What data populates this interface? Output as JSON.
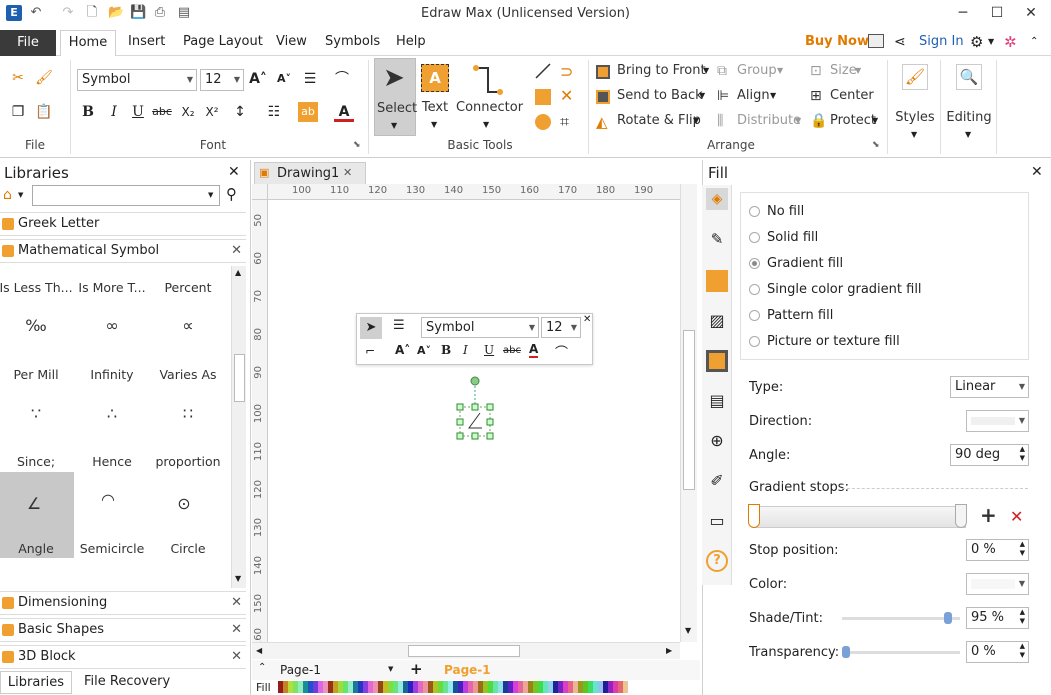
{
  "window": {
    "title": "Edraw Max (Unlicensed Version)",
    "minimize": "─",
    "maximize": "☐",
    "close": "✕"
  },
  "menu": {
    "file": "File",
    "home": "Home",
    "insert": "Insert",
    "page_layout": "Page Layout",
    "view": "View",
    "symbols": "Symbols",
    "help": "Help",
    "buy_now": "Buy Now",
    "sign_in": "Sign In"
  },
  "ribbon": {
    "groups": {
      "file": "File",
      "font": "Font",
      "basic_tools": "Basic Tools",
      "arrange": "Arrange"
    },
    "font_name": "Symbol",
    "font_size": "12",
    "select": "Select",
    "text": "Text",
    "connector": "Connector",
    "bring_to_front": "Bring to Front",
    "send_to_back": "Send to Back",
    "rotate_flip": "Rotate & Flip",
    "group": "Group",
    "align": "Align",
    "distribute": "Distribute",
    "size": "Size",
    "center": "Center",
    "protect": "Protect",
    "styles": "Styles",
    "editing": "Editing"
  },
  "libraries": {
    "title": "Libraries",
    "search_placeholder": "",
    "sections": [
      "Greek Letter",
      "Mathematical Symbol",
      "Dimensioning",
      "Basic Shapes",
      "3D Block"
    ],
    "symbols": [
      {
        "label": "Is Less Th...",
        "glyph": ""
      },
      {
        "label": "Is More T...",
        "glyph": ""
      },
      {
        "label": "Percent",
        "glyph": ""
      },
      {
        "label": "Per Mill",
        "glyph": "‰"
      },
      {
        "label": "Infinity",
        "glyph": "∞"
      },
      {
        "label": "Varies As",
        "glyph": "∝"
      },
      {
        "label": "Since; Bec...",
        "glyph": "∵"
      },
      {
        "label": "Hence",
        "glyph": "∴"
      },
      {
        "label": "proportion",
        "glyph": "∷"
      },
      {
        "label": "Angle",
        "glyph": "∠"
      },
      {
        "label": "Semicircle",
        "glyph": "◠"
      },
      {
        "label": "Circle",
        "glyph": "⊙"
      }
    ],
    "bottom_tabs": [
      "Libraries",
      "File Recovery"
    ]
  },
  "document": {
    "tab": "Drawing1",
    "ruler_h": [
      "100",
      "110",
      "120",
      "130",
      "140",
      "150",
      "160",
      "170",
      "180",
      "190"
    ],
    "ruler_v": [
      "50",
      "60",
      "70",
      "80",
      "90",
      "100",
      "110",
      "120",
      "130",
      "140",
      "150",
      "160"
    ],
    "float_font": "Symbol",
    "float_size": "12",
    "page_selector": "Page-1",
    "page_tab": "Page-1",
    "fill_label": "Fill"
  },
  "fill": {
    "title": "Fill",
    "options": [
      "No fill",
      "Solid fill",
      "Gradient fill",
      "Single color gradient fill",
      "Pattern fill",
      "Picture or texture fill"
    ],
    "selected": "Gradient fill",
    "type_label": "Type:",
    "type_value": "Linear",
    "direction_label": "Direction:",
    "angle_label": "Angle:",
    "angle_value": "90 deg",
    "gradient_stops_label": "Gradient stops:",
    "stop_position_label": "Stop position:",
    "stop_position_value": "0 %",
    "color_label": "Color:",
    "shade_label": "Shade/Tint:",
    "shade_value": "95 %",
    "transparency_label": "Transparency:",
    "transparency_value": "0 %"
  },
  "colors": {
    "accent": "#f0a030",
    "file_tab": "#3a3a3a",
    "buy_now": "#e07b00",
    "link_blue": "#2060b0",
    "delete_red": "#d02020"
  }
}
